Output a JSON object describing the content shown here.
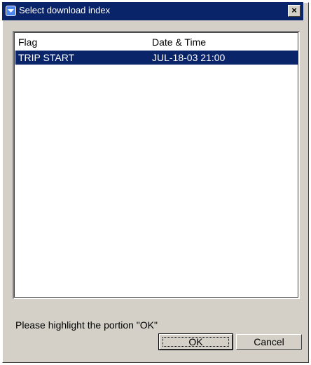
{
  "window": {
    "title": "Select download index",
    "close_glyph": "×",
    "title_icon": "app-window-icon",
    "title_bar_color": "#0a246a"
  },
  "list": {
    "headers": {
      "flag": "Flag",
      "datetime": "Date & Time"
    },
    "rows": [
      {
        "flag": "TRIP START",
        "datetime": "JUL-18-03 21:00",
        "selected": true
      }
    ],
    "selection_color": "#0a246a"
  },
  "footer": {
    "hint": "Please highlight the portion \"OK\"",
    "ok_label": "OK",
    "cancel_label": "Cancel"
  }
}
